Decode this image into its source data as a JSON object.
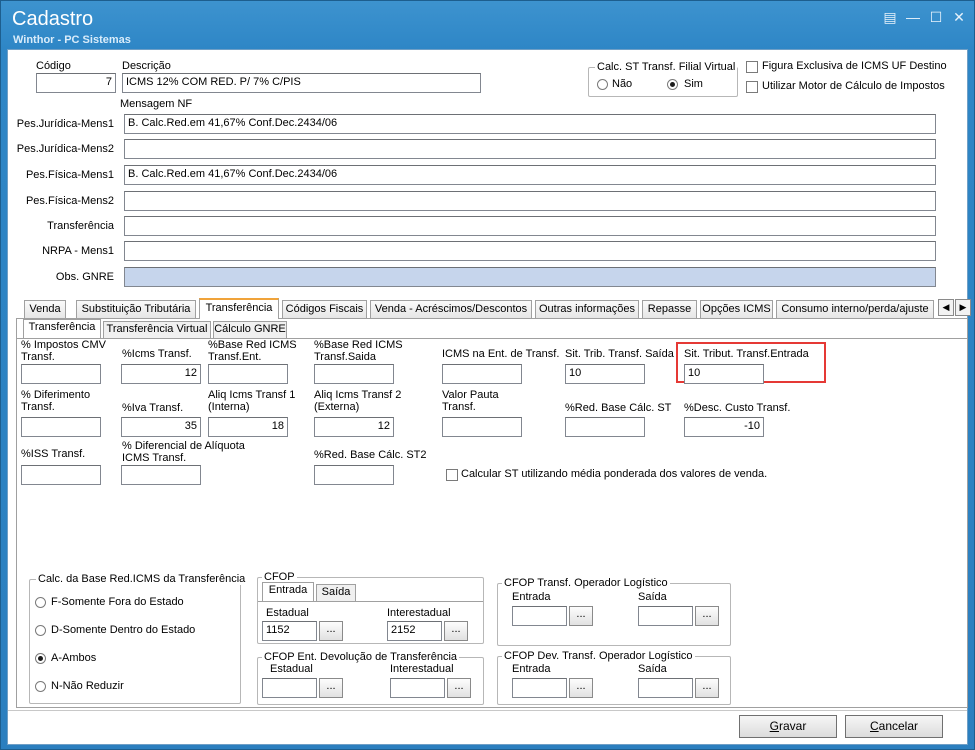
{
  "window": {
    "title": "Cadastro",
    "subtitle": "Winthor - PC Sistemas"
  },
  "header": {
    "codigo_label": "Código",
    "codigo_value": "7",
    "descricao_label": "Descrição",
    "descricao_value": "ICMS 12% COM RED. P/ 7% C/PIS",
    "calc_st_group_title": "Calc. ST Transf. Filial Virtual",
    "radio_nao": "Não",
    "radio_sim": "Sim",
    "selected": "Sim",
    "check_figura": "Figura Exclusiva de ICMS UF Destino",
    "check_motor": "Utilizar Motor de Cálculo de Impostos",
    "mensagem_nf_label": "Mensagem NF"
  },
  "messages": [
    {
      "label": "Pes.Jurídica-Mens1",
      "value": "B. Calc.Red.em 41,67% Conf.Dec.2434/06"
    },
    {
      "label": "Pes.Jurídica-Mens2",
      "value": ""
    },
    {
      "label": "Pes.Física-Mens1",
      "value": "B. Calc.Red.em 41,67% Conf.Dec.2434/06"
    },
    {
      "label": "Pes.Física-Mens2",
      "value": ""
    },
    {
      "label": "Transferência",
      "value": ""
    },
    {
      "label": "NRPA - Mens1",
      "value": ""
    },
    {
      "label": "Obs. GNRE",
      "value": ""
    }
  ],
  "tabs": [
    "Venda",
    "Substituição Tributária",
    "Transferência",
    "Códigos Fiscais",
    "Venda - Acréscimos/Descontos",
    "Outras informações",
    "Repasse",
    "Opções ICMS",
    "Consumo interno/perda/ajuste"
  ],
  "active_tab": "Transferência",
  "subtabs": [
    "Transferência",
    "Transferência Virtual",
    "Cálculo GNRE"
  ],
  "active_subtab": "Transferência",
  "fields": {
    "impostos_cmv": {
      "label": "% Impostos CMV Transf.",
      "value": ""
    },
    "icms_transf": {
      "label": "%Icms Transf.",
      "value": "12"
    },
    "base_red_ent": {
      "label": "%Base Red ICMS Transf.Ent.",
      "value": ""
    },
    "base_red_saida": {
      "label": "%Base Red ICMS Transf.Saida",
      "value": ""
    },
    "icms_ent_transf": {
      "label": "ICMS na Ent. de Transf.",
      "value": ""
    },
    "sit_trib_saida": {
      "label": "Sit. Trib. Transf. Saída",
      "value": "10"
    },
    "sit_trib_entrada": {
      "label": "Sit. Tribut. Transf.Entrada",
      "value": "10"
    },
    "diferimento": {
      "label": "% Diferimento Transf.",
      "value": ""
    },
    "iva_transf": {
      "label": "%Iva Transf.",
      "value": "35"
    },
    "aliq_1": {
      "label": "Aliq Icms Transf 1 (Interna)",
      "value": "18"
    },
    "aliq_2": {
      "label": "Aliq Icms Transf 2 (Externa)",
      "value": "12"
    },
    "valor_pauta": {
      "label": "Valor Pauta Transf.",
      "value": ""
    },
    "red_base_st": {
      "label": "%Red. Base Cálc. ST",
      "value": ""
    },
    "desc_custo": {
      "label": "%Desc. Custo Transf.",
      "value": "-10"
    },
    "iss_transf": {
      "label": "%ISS  Transf.",
      "value": ""
    },
    "dif_aliquota": {
      "label": "% Diferencial de Alíquota ICMS Transf.",
      "value": ""
    },
    "red_base_st2": {
      "label": "%Red. Base Cálc. ST2",
      "value": ""
    }
  },
  "check_media": "Calcular ST utilizando média ponderada dos valores de venda.",
  "base_red_group": {
    "title": "Calc. da Base Red.ICMS da Transferência",
    "options": [
      "F-Somente Fora do Estado",
      "D-Somente Dentro do Estado",
      "A-Ambos",
      "N-Não Reduzir"
    ],
    "selected": "A-Ambos"
  },
  "cfop": {
    "title": "CFOP",
    "tabs": [
      "Entrada",
      "Saída"
    ],
    "estadual_label": "Estadual",
    "estadual_value": "1152",
    "interestadual_label": "Interestadual",
    "interestadual_value": "2152",
    "dots": "..."
  },
  "cfop_dev": {
    "title": "CFOP Ent. Devolução de Transferência",
    "estadual_label": "Estadual",
    "interestadual_label": "Interestadual"
  },
  "cfop_op_log": {
    "title": "CFOP Transf. Operador Logístico",
    "entrada_label": "Entrada",
    "saida_label": "Saída"
  },
  "cfop_dev_op_log": {
    "title": "CFOP Dev. Transf. Operador Logístico",
    "entrada_label": "Entrada",
    "saida_label": "Saída"
  },
  "actions": {
    "gravar_pre": "",
    "gravar_u": "G",
    "gravar_post": "ravar",
    "cancelar_pre": "",
    "cancelar_u": "C",
    "cancelar_post": "ancelar"
  },
  "colors": {
    "title_bar": "#2e86c6",
    "highlight": "#e53935",
    "active_tab_accent": "#f0a33a"
  }
}
